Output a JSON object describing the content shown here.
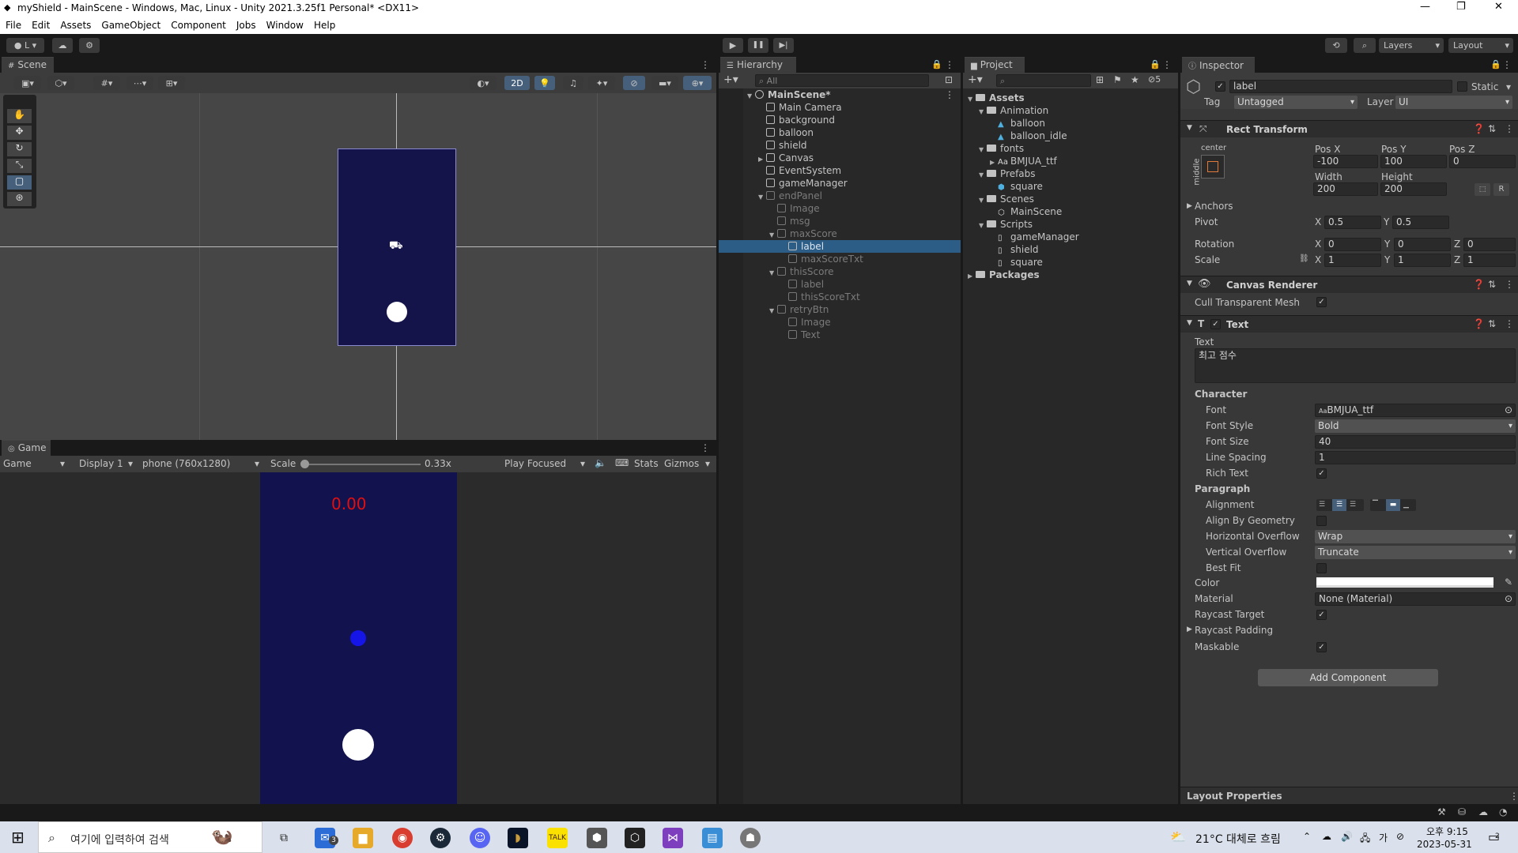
{
  "window": {
    "title": "myShield - MainScene - Windows, Mac, Linux - Unity 2021.3.25f1 Personal* <DX11>",
    "controls": [
      "—",
      "❐",
      "✕"
    ]
  },
  "menu": [
    "File",
    "Edit",
    "Assets",
    "GameObject",
    "Component",
    "Jobs",
    "Window",
    "Help"
  ],
  "toolbar": {
    "account_label": "L",
    "play": "▶",
    "pause": "❚❚",
    "step": "▶|",
    "layers": "Layers",
    "layout": "Layout"
  },
  "scene": {
    "tab": "Scene",
    "mode_2d": "2D"
  },
  "game": {
    "tab": "Game",
    "mode": "Game",
    "display": "Display 1",
    "resolution": "phone (760x1280)",
    "scale_label": "Scale",
    "scale_value": "0.33x",
    "play_focused": "Play Focused",
    "stats": "Stats",
    "gizmos": "Gizmos",
    "score_text": "0.00"
  },
  "hierarchy": {
    "tab": "Hierarchy",
    "search_placeholder": "All",
    "items": [
      {
        "label": "MainScene*",
        "state": "scene"
      },
      {
        "label": "Main Camera",
        "state": "normal"
      },
      {
        "label": "background",
        "state": "normal"
      },
      {
        "label": "balloon",
        "state": "normal"
      },
      {
        "label": "shield",
        "state": "normal"
      },
      {
        "label": "Canvas",
        "state": "normal"
      },
      {
        "label": "EventSystem",
        "state": "normal"
      },
      {
        "label": "gameManager",
        "state": "normal"
      },
      {
        "label": "endPanel",
        "state": "inactive"
      },
      {
        "label": "Image",
        "state": "inactive"
      },
      {
        "label": "msg",
        "state": "inactive"
      },
      {
        "label": "maxScore",
        "state": "inactive"
      },
      {
        "label": "label",
        "state": "selected"
      },
      {
        "label": "maxScoreTxt",
        "state": "inactive"
      },
      {
        "label": "thisScore",
        "state": "inactive"
      },
      {
        "label": "label",
        "state": "inactive"
      },
      {
        "label": "thisScoreTxt",
        "state": "inactive"
      },
      {
        "label": "retryBtn",
        "state": "inactive"
      },
      {
        "label": "Image",
        "state": "inactive"
      },
      {
        "label": "Text",
        "state": "inactive"
      }
    ]
  },
  "project": {
    "tab": "Project",
    "hidden_count": "5",
    "items": [
      {
        "label": "Assets",
        "kind": "folder-bold"
      },
      {
        "label": "Animation",
        "kind": "folder"
      },
      {
        "label": "balloon",
        "kind": "anim"
      },
      {
        "label": "balloon_idle",
        "kind": "anim"
      },
      {
        "label": "fonts",
        "kind": "folder"
      },
      {
        "label": "BMJUA_ttf",
        "kind": "font"
      },
      {
        "label": "Prefabs",
        "kind": "folder"
      },
      {
        "label": "square",
        "kind": "prefab"
      },
      {
        "label": "Scenes",
        "kind": "folder"
      },
      {
        "label": "MainScene",
        "kind": "scene"
      },
      {
        "label": "Scripts",
        "kind": "folder"
      },
      {
        "label": "gameManager",
        "kind": "script"
      },
      {
        "label": "shield",
        "kind": "script"
      },
      {
        "label": "square",
        "kind": "script"
      },
      {
        "label": "Packages",
        "kind": "folder-bold"
      }
    ]
  },
  "inspector": {
    "tab": "Inspector",
    "name": "label",
    "static_label": "Static",
    "tag_label": "Tag",
    "tag_value": "Untagged",
    "layer_label": "Layer",
    "layer_value": "UI",
    "rect_transform": {
      "title": "Rect Transform",
      "anchor_h": "center",
      "anchor_v": "middle",
      "posx_label": "Pos X",
      "posx": "-100",
      "posy_label": "Pos Y",
      "posy": "100",
      "posz_label": "Pos Z",
      "posz": "0",
      "width_label": "Width",
      "width": "200",
      "height_label": "Height",
      "height": "200",
      "r_button": "R",
      "anchors": "Anchors",
      "pivot": "Pivot",
      "pivot_x": "0.5",
      "pivot_y": "0.5",
      "rotation": "Rotation",
      "rot_x": "0",
      "rot_y": "0",
      "rot_z": "0",
      "scale": "Scale",
      "scale_x": "1",
      "scale_y": "1",
      "scale_z": "1",
      "x": "X",
      "y": "Y",
      "z": "Z"
    },
    "canvas_renderer": {
      "title": "Canvas Renderer",
      "cull": "Cull Transparent Mesh"
    },
    "text": {
      "title": "Text",
      "text_label": "Text",
      "text_value": "최고 점수",
      "character": "Character",
      "font_label": "Font",
      "font_value": "BMJUA_ttf",
      "font_style_label": "Font Style",
      "font_style_value": "Bold",
      "font_size_label": "Font Size",
      "font_size_value": "40",
      "line_spacing_label": "Line Spacing",
      "line_spacing_value": "1",
      "rich_text_label": "Rich Text",
      "paragraph": "Paragraph",
      "alignment_label": "Alignment",
      "align_geom_label": "Align By Geometry",
      "hoverflow_label": "Horizontal Overflow",
      "hoverflow_value": "Wrap",
      "voverflow_label": "Vertical Overflow",
      "voverflow_value": "Truncate",
      "best_fit_label": "Best Fit",
      "color_label": "Color",
      "material_label": "Material",
      "material_value": "None (Material)",
      "raycast_target_label": "Raycast Target",
      "raycast_padding_label": "Raycast Padding",
      "maskable_label": "Maskable"
    },
    "add_component": "Add Component",
    "layout_properties": "Layout Properties"
  },
  "taskbar": {
    "search_placeholder": "여기에 입력하여 검색",
    "weather": "21°C 대체로 흐림",
    "time": "오후 9:15",
    "date": "2023-05-31",
    "mail_badge": "3",
    "notification_count": "2"
  },
  "colors": {
    "game_bg": "#12124f",
    "scene_rect": "#14144a",
    "selection": "#2c5d87",
    "score_red": "#e01010",
    "ball_blue": "#1515e8"
  }
}
